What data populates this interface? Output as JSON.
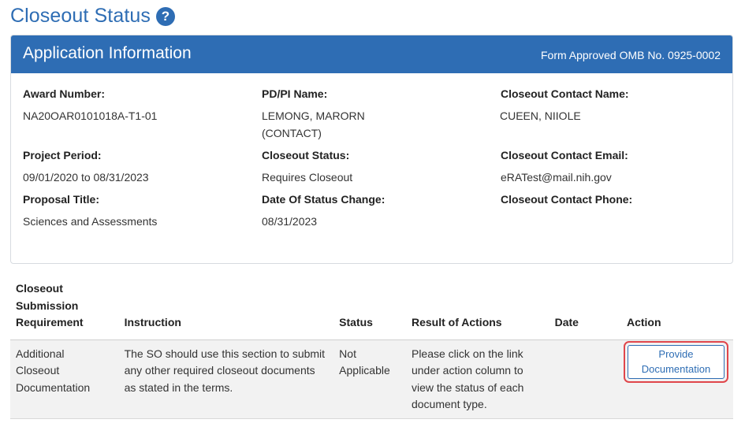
{
  "page": {
    "title": "Closeout Status",
    "help_icon": "question-circle-icon"
  },
  "panel": {
    "title": "Application Information",
    "omb": "Form Approved OMB No. 0925-0002",
    "fields": {
      "award_number": {
        "label": "Award Number:",
        "value": "NA20OAR0101018A-T1-01"
      },
      "pdpi_name": {
        "label": "PD/PI Name:",
        "value_line1": "LEMONG, MARORN",
        "value_line2": "(CONTACT)"
      },
      "contact_name": {
        "label": "Closeout Contact Name:",
        "value": "CUEEN, NIIOLE"
      },
      "project_period": {
        "label": "Project Period:",
        "value": "09/01/2020 to 08/31/2023"
      },
      "closeout_status": {
        "label": "Closeout Status:",
        "value": "Requires Closeout"
      },
      "contact_email": {
        "label": "Closeout Contact Email:",
        "value": "eRATest@mail.nih.gov"
      },
      "proposal_title": {
        "label": "Proposal Title:",
        "value": "Sciences and Assessments"
      },
      "date_status_change": {
        "label": "Date Of Status Change:",
        "value": "08/31/2023"
      },
      "contact_phone": {
        "label": "Closeout Contact Phone:",
        "value": ""
      }
    }
  },
  "table": {
    "headers": {
      "requirement": [
        "Closeout",
        "Submission",
        "Requirement"
      ],
      "instruction": "Instruction",
      "status": "Status",
      "result": "Result of Actions",
      "date": "Date",
      "action": "Action"
    },
    "rows": [
      {
        "requirement": [
          "Additional",
          "Closeout",
          "Documentation"
        ],
        "instruction": [
          "The SO should use this section to submit",
          "any other required closeout documents",
          "as stated in the terms."
        ],
        "status": [
          "Not",
          "Applicable"
        ],
        "result": [
          "Please click on the link",
          "under action column to",
          "view the status of each",
          "document type."
        ],
        "date": "",
        "action": [
          "Provide",
          "Documentation"
        ]
      }
    ]
  }
}
